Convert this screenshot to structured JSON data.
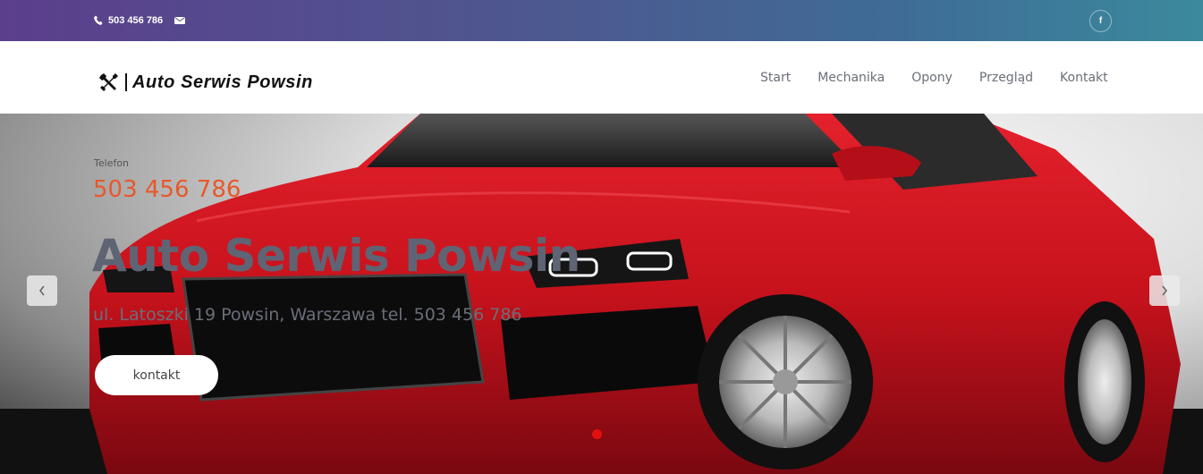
{
  "topbar": {
    "phone": "503 456 786",
    "phone_icon": "phone-icon",
    "mail_icon": "envelope-icon",
    "social": "f"
  },
  "brand": {
    "name": "Auto Serwis Powsin",
    "icon": "tools-icon"
  },
  "nav": {
    "items": [
      "Start",
      "Mechanika",
      "Opony",
      "Przegląd",
      "Kontakt"
    ]
  },
  "hero": {
    "phone_label": "Telefon",
    "phone": "503 456 786",
    "title": "Auto Serwis Powsin",
    "address": "ul. Latoszki 19 Powsin, Warszawa tel. 503 456 786",
    "button": "kontakt"
  },
  "colors": {
    "accent": "#e8582a",
    "slider_dot": "#e31010",
    "title": "#5f6474"
  }
}
